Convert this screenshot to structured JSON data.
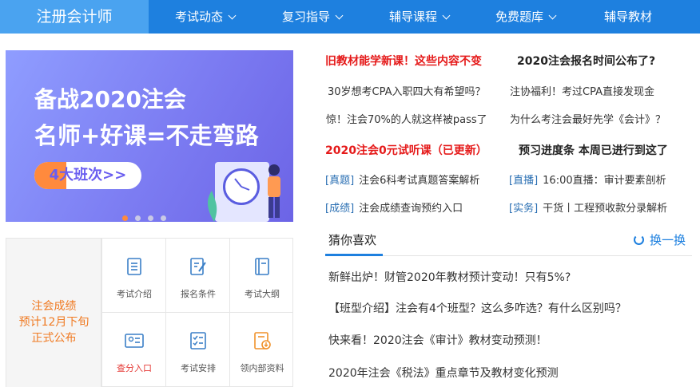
{
  "nav": {
    "brand": "注册会计师",
    "items": [
      {
        "label": "考试动态"
      },
      {
        "label": "复习指导"
      },
      {
        "label": "辅导课程"
      },
      {
        "label": "免费题库"
      },
      {
        "label": "辅导教材"
      }
    ]
  },
  "banner": {
    "line1": "备战2020注会",
    "line2": "名师+好课=不走弯路",
    "cta": "4大班次>>",
    "active_slide": 1,
    "slide_count": 4
  },
  "promo": {
    "lines": [
      "注会成绩",
      "预计12月下旬",
      "正式公布"
    ]
  },
  "grid": {
    "items": [
      {
        "label": "考试介绍"
      },
      {
        "label": "报名条件"
      },
      {
        "label": "考试大纲"
      },
      {
        "label": "查分入口"
      },
      {
        "label": "考试安排"
      },
      {
        "label": "领内部资料"
      }
    ]
  },
  "news": {
    "headline1_left": "旧教材能学新课！这些内容不变",
    "headline1_right": "2020注会报名时间公布了?",
    "row1_left": "30岁想考CPA入职四大有希望吗？",
    "row1_right": "注协福利！考过CPA直接发现金",
    "row2_left": "惊！注会70%的人就这样被pass了",
    "row2_right": "为什么考注会最好先学《会计》？",
    "headline2_left": "2020注会0元试听课（已更新）",
    "headline2_right": "预习进度条 本周已进行到这了",
    "tag_row1_left_tag": "[真题]",
    "tag_row1_left_text": "注会6科考试真题答案解析",
    "tag_row1_right_tag": "[直播]",
    "tag_row1_right_text": "16:00直播：审计要素剖析",
    "tag_row2_left_tag": "[成绩]",
    "tag_row2_left_text": "注会成绩查询预约入口",
    "tag_row2_right_tag": "[实务]",
    "tag_row2_right_text": "干货丨工程预收款分录解析"
  },
  "guess": {
    "title": "猜你喜欢",
    "refresh": "换一换",
    "items": [
      "新鲜出炉！财管2020年教材预计变动！只有5%?",
      "【班型介绍】注会有4个班型？这么多咋选？有什么区别吗？",
      "快来看！2020注会《审计》教材变动预测！",
      "2020年注会《税法》重点章节及教材变化预测"
    ]
  },
  "colors": {
    "nav_bg": "#1e80df",
    "brand_bg": "#4aa3f0",
    "headline_red": "#e51a1a",
    "tag_blue": "#2a6fb3",
    "promo_orange": "#f07a22"
  }
}
